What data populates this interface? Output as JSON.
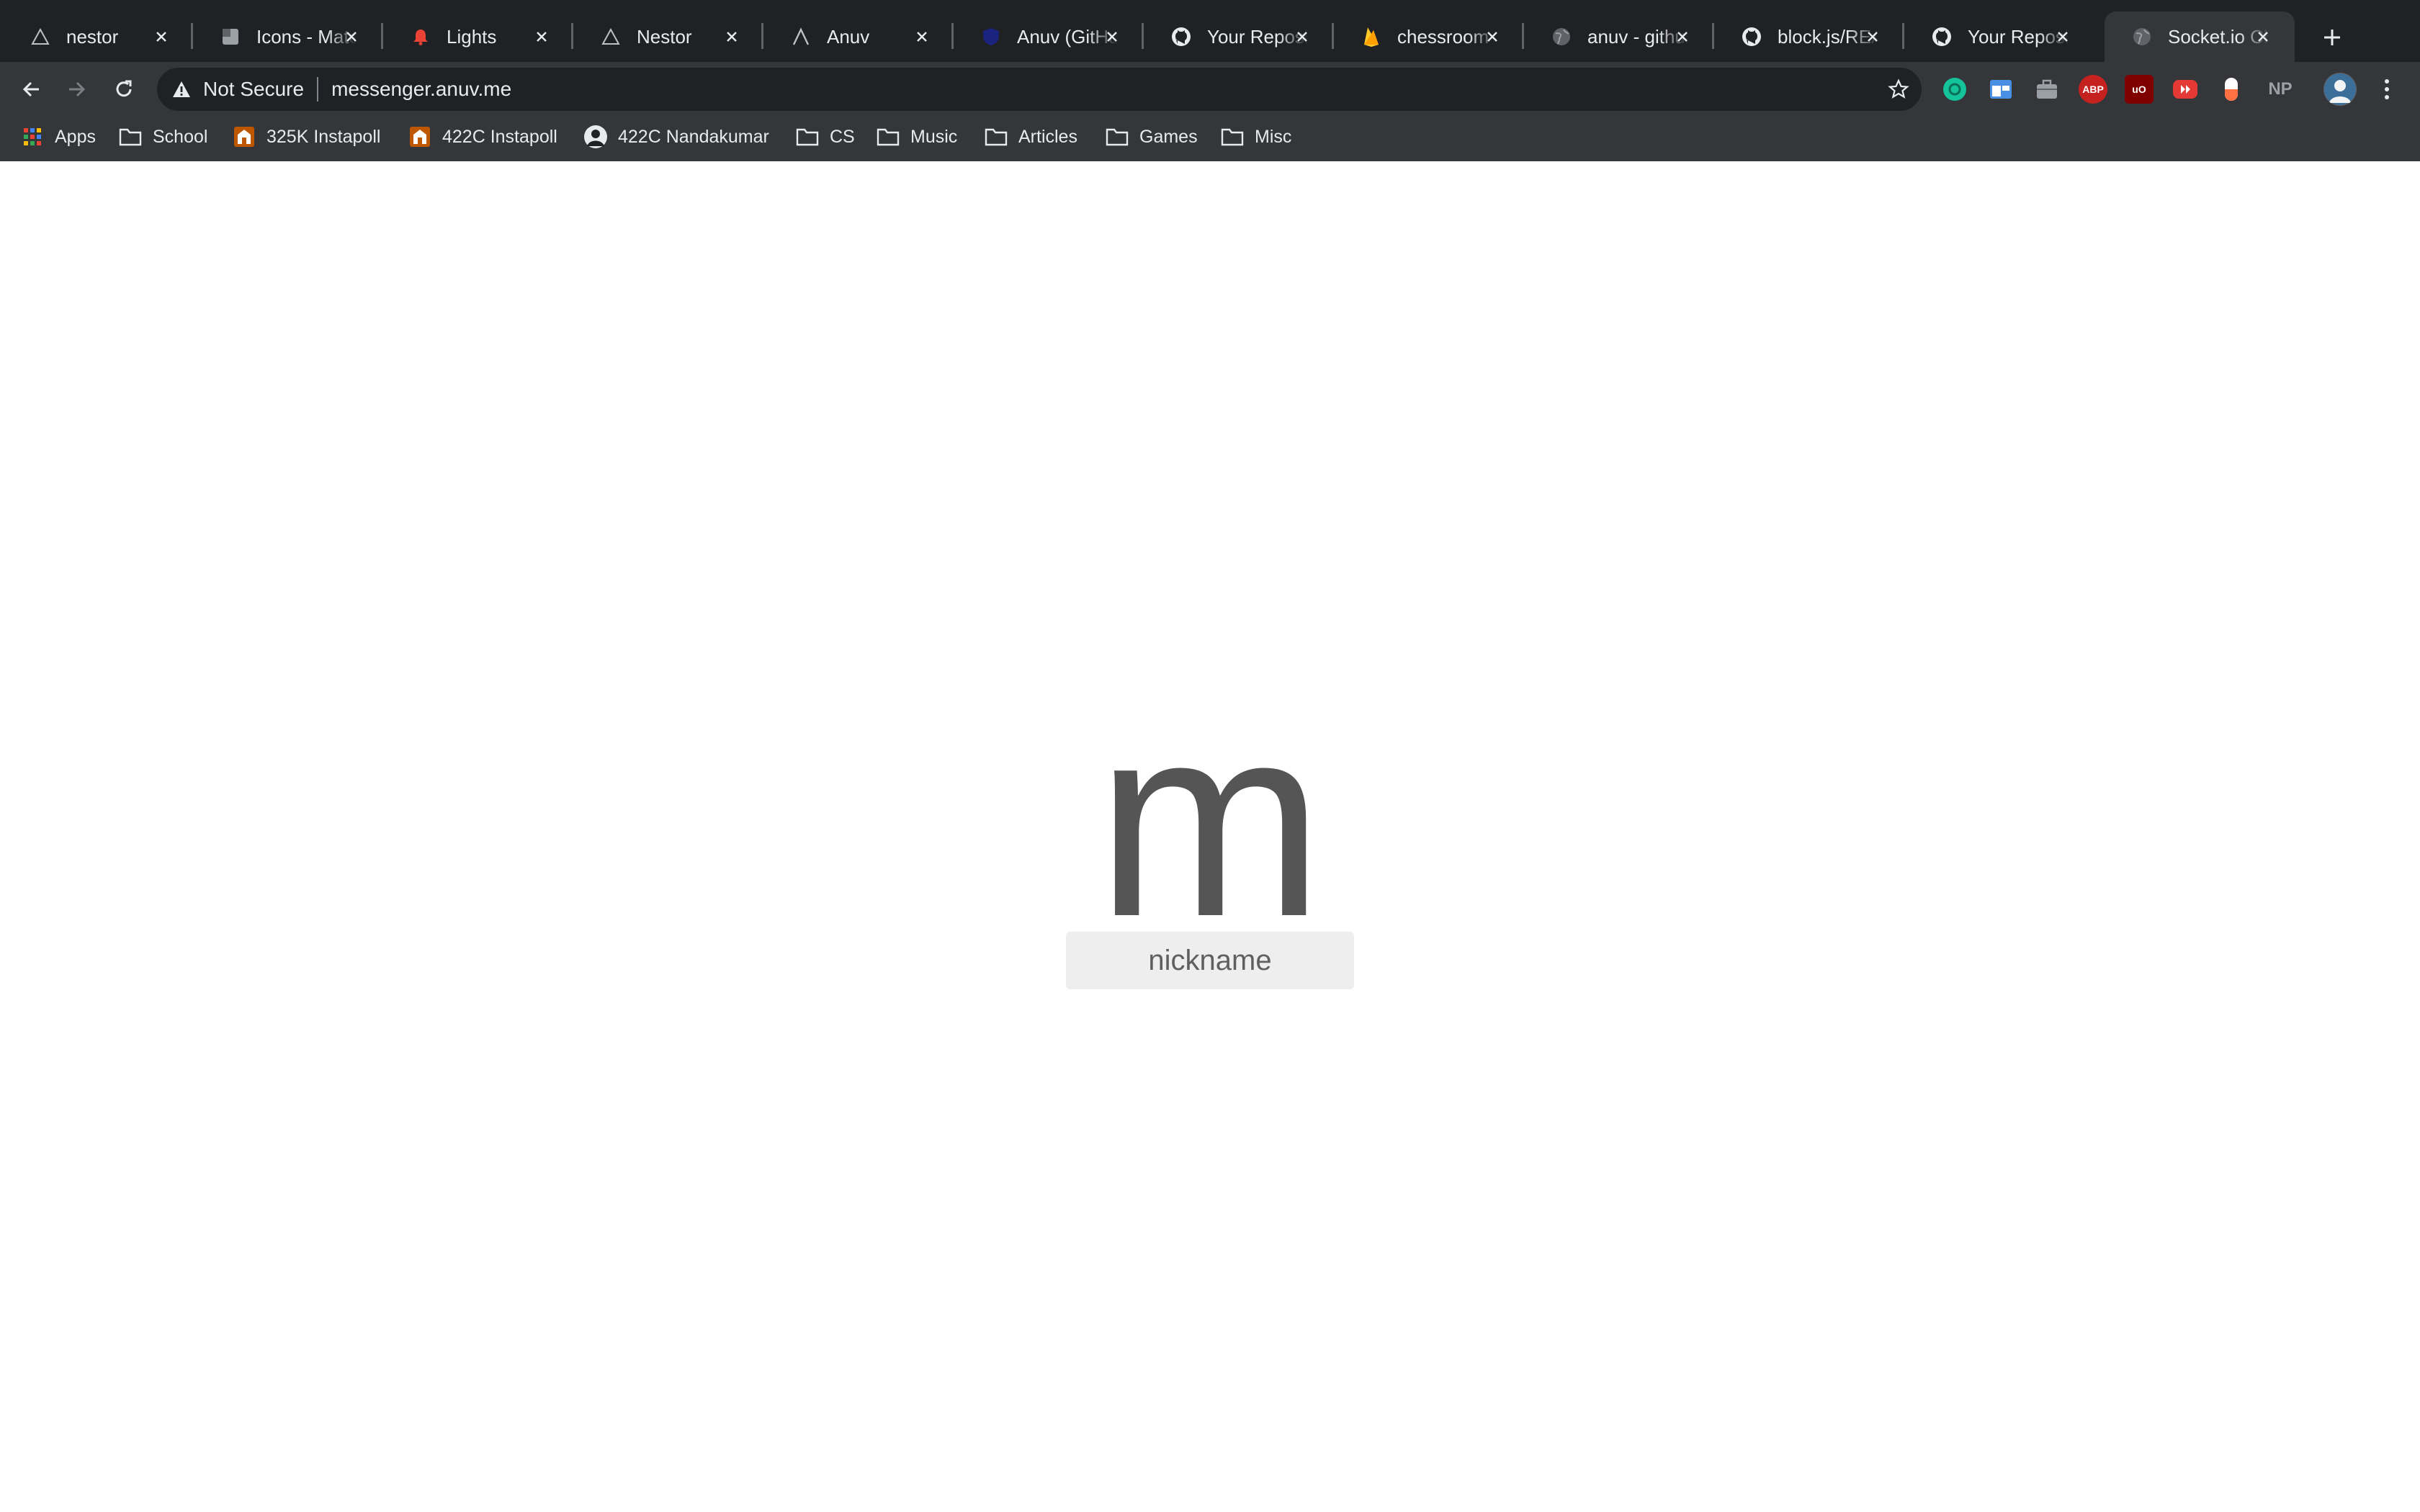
{
  "tabs": [
    {
      "title": "nestor",
      "icon": "triangle-icon"
    },
    {
      "title": "Icons - Material",
      "icon": "material-icon"
    },
    {
      "title": "Lights",
      "icon": "bell-icon"
    },
    {
      "title": "Nestor",
      "icon": "triangle-icon"
    },
    {
      "title": "Anuv",
      "icon": "lambda-icon"
    },
    {
      "title": "Anuv (GitHub)",
      "icon": "shield-icon"
    },
    {
      "title": "Your Repositories",
      "icon": "github-icon"
    },
    {
      "title": "chessroom",
      "icon": "firebase-icon"
    },
    {
      "title": "anuv - github",
      "icon": "globe-icon"
    },
    {
      "title": "block.js/README",
      "icon": "github-icon"
    },
    {
      "title": "Your Repositories",
      "icon": "github-icon"
    },
    {
      "title": "Socket.io Chat",
      "icon": "globe-icon",
      "active": true
    }
  ],
  "omnibox": {
    "security_label": "Not Secure",
    "url": "messenger.anuv.me"
  },
  "bookmarks": [
    {
      "label": "Apps",
      "icon": "apps-grid-icon"
    },
    {
      "label": "School",
      "icon": "folder-icon"
    },
    {
      "label": "325K Instapoll",
      "icon": "instapoll-icon"
    },
    {
      "label": "422C Instapoll",
      "icon": "instapoll-icon"
    },
    {
      "label": "422C Nandakumar",
      "icon": "avatar-icon"
    },
    {
      "label": "CS",
      "icon": "folder-icon"
    },
    {
      "label": "Music",
      "icon": "folder-icon"
    },
    {
      "label": "Articles",
      "icon": "folder-icon"
    },
    {
      "label": "Games",
      "icon": "folder-icon"
    },
    {
      "label": "Misc",
      "icon": "folder-icon"
    }
  ],
  "extensions": [
    "ABP",
    "uO",
    "NP"
  ],
  "page": {
    "logo": "m",
    "nickname_placeholder": "nickname"
  },
  "colors": {
    "tabstrip": "#202124",
    "toolbar": "#35363a",
    "logo_text": "#555555",
    "input_bg": "#eeeeee"
  }
}
